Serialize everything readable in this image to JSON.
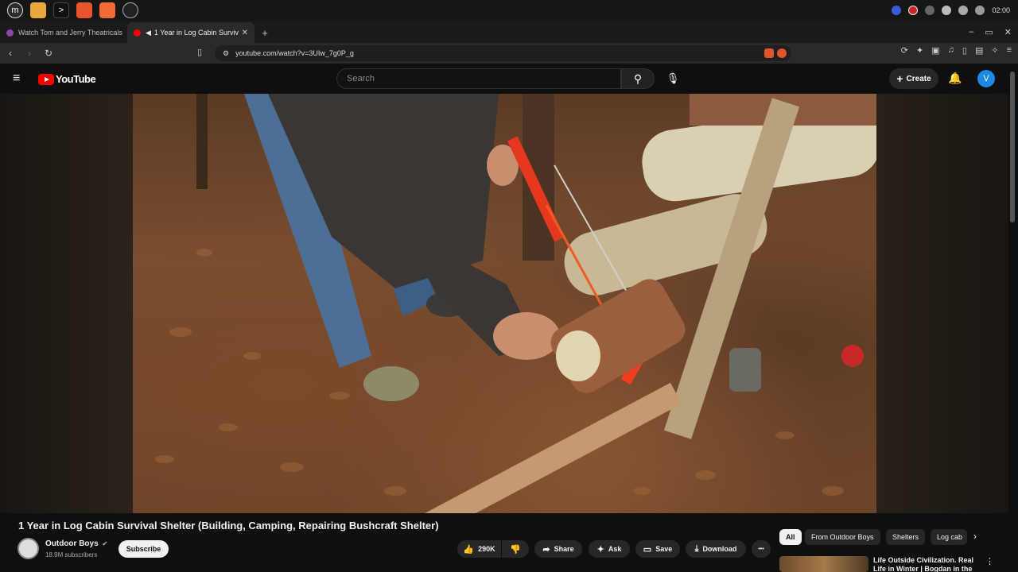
{
  "colors": {
    "youtube_red": "#ff0000",
    "avatar_blue": "#1e88e5",
    "brave_orange": "#e2552c"
  },
  "os": {
    "clock": "02:00",
    "icons": [
      "mint-menu-icon",
      "files-icon",
      "terminal-icon",
      "firefox-icon",
      "brave-icon",
      "chrome-icon"
    ]
  },
  "browser": {
    "tabs": [
      {
        "title": "Watch Tom and Jerry Theatricals"
      },
      {
        "title": "1 Year in Log Cabin Surviv"
      }
    ],
    "new_tab": "+",
    "url": "youtube.com/watch?v=3UIw_7g0P_g",
    "window_min": "–",
    "window_max": "▭",
    "window_close": "✕"
  },
  "youtube": {
    "logo_text": "YouTube",
    "search_placeholder": "Search",
    "create_label": "Create",
    "avatar_letter": "V"
  },
  "video": {
    "title": "1 Year in Log Cabin Survival Shelter (Building, Camping, Repairing Bushcraft Shelter)",
    "channel": {
      "name": "Outdoor Boys",
      "verified": "✔",
      "subscribers": "18.9M subscribers"
    },
    "subscribe_label": "Subscribe",
    "actions": {
      "likes": "290K",
      "share": "Share",
      "ask": "Ask",
      "save": "Save",
      "download": "Download",
      "more": "•••"
    }
  },
  "filter_chips": [
    "All",
    "From Outdoor Boys",
    "Shelters",
    "Log cab"
  ],
  "recommended": {
    "title": "Life Outside Civilization. Real Life in Winter | Bogdan in the"
  }
}
